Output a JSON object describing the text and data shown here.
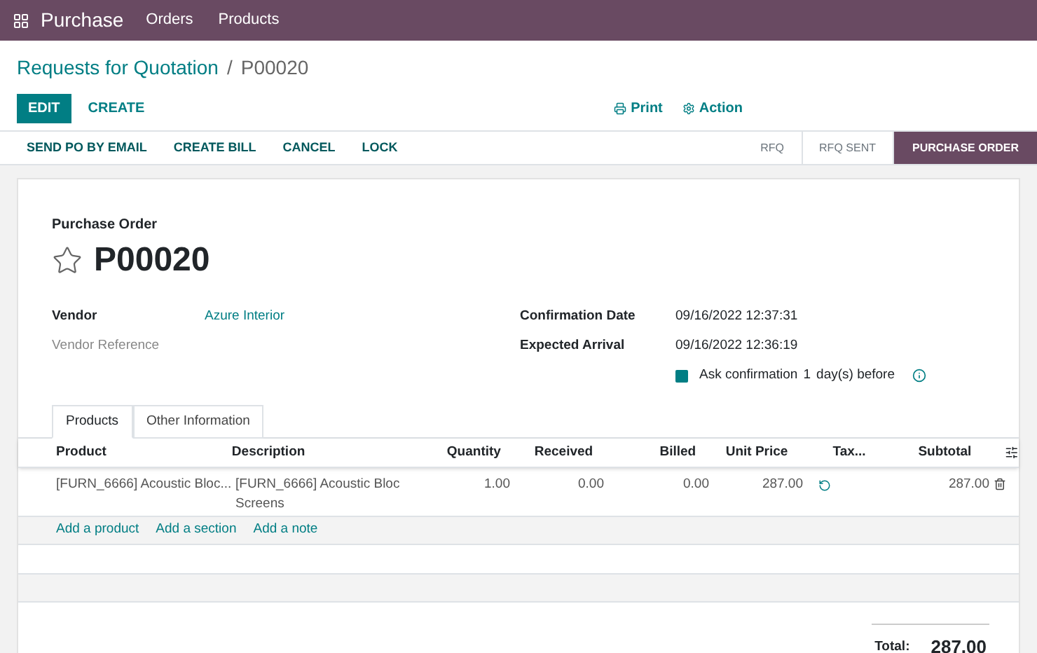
{
  "navbar": {
    "app": "Purchase",
    "menu": [
      "Orders",
      "Products"
    ]
  },
  "breadcrumb": {
    "parent": "Requests for Quotation",
    "separator": "/",
    "current": "P00020"
  },
  "control_buttons": [
    {
      "label": "EDIT",
      "kind": "primary"
    },
    {
      "label": "CREATE",
      "kind": "secondary"
    }
  ],
  "actions": [
    {
      "label": "Print",
      "kind": "print"
    },
    {
      "label": "Action",
      "kind": "gear"
    }
  ],
  "header_buttons": [
    "SEND PO BY EMAIL",
    "CREATE BILL",
    "CANCEL",
    "LOCK"
  ],
  "stages": [
    {
      "label": "RFQ",
      "selected": false
    },
    {
      "label": "RFQ SENT",
      "selected": false
    },
    {
      "label": "PURCHASE ORDER",
      "selected": true
    }
  ],
  "sheet": {
    "subtitle": "Purchase Order",
    "name": "P00020",
    "starred": false,
    "left_fields": [
      {
        "label": "Vendor",
        "value": "Azure Interior",
        "muted": false
      },
      {
        "label": "Vendor Reference",
        "muted": true
      }
    ],
    "right_fields": [
      {
        "label": "Confirmation Date",
        "value": "09/16/2022 12:37:31"
      },
      {
        "label": "Expected Arrival",
        "value": "09/16/2022 12:36:19"
      }
    ],
    "ask_confirmation": {
      "checked": true,
      "before": "Ask confirmation",
      "days": "1",
      "after": "day(s) before"
    },
    "tabs": [
      {
        "label": "Products",
        "selected": true
      },
      {
        "label": "Other Information",
        "selected": false
      }
    ],
    "table": {
      "columns": [
        "Product",
        "Description",
        "Quantity",
        "Received",
        "Billed",
        "Unit Price",
        "Tax...",
        "Subtotal"
      ],
      "rows": [
        {
          "product": "[FURN_6666] Acoustic Bloc...",
          "description": "[FURN_6666] Acoustic Bloc Screens",
          "quantity": "1.00",
          "received": "0.00",
          "billed": "0.00",
          "unit_price": "287.00",
          "subtotal": "287.00"
        }
      ],
      "add_links": [
        "Add a product",
        "Add a section",
        "Add a note"
      ]
    },
    "total": {
      "label": "Total:",
      "value": "287.00"
    }
  }
}
